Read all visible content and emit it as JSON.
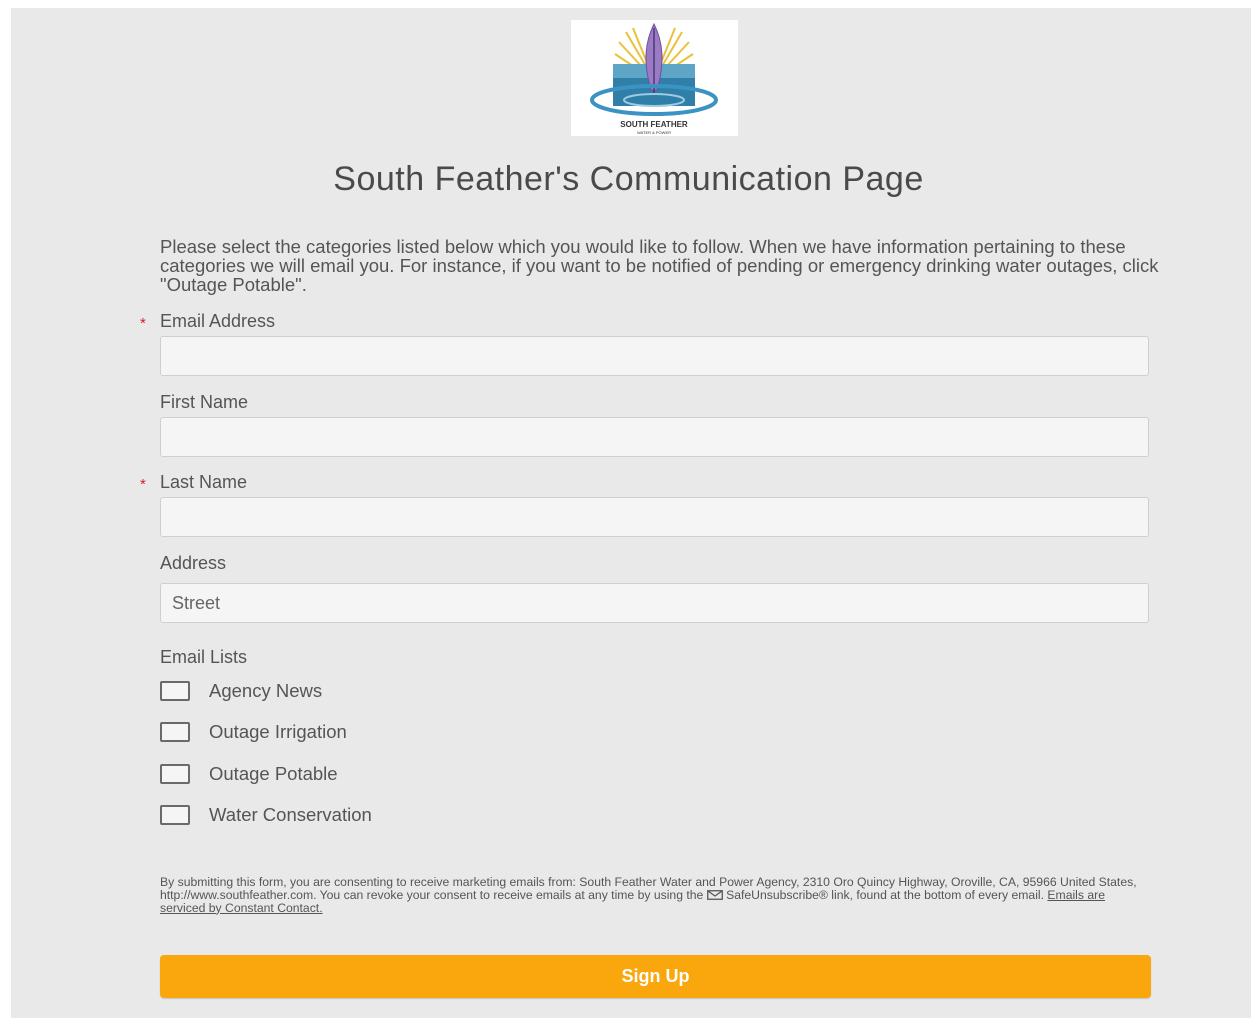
{
  "logo": {
    "text": "SOUTH FEATHER",
    "subtext": "WATER & POWER"
  },
  "page_title": "South Feather's Communication Page",
  "intro": "Please select the categories listed below which you would like to follow. When we have information pertaining to these categories we will email you. For instance, if you want to be notified of pending or emergency drinking water outages, click \"Outage Potable\".",
  "form": {
    "required_marker": "*",
    "email_label": "Email Address",
    "email_value": "",
    "first_name_label": "First Name",
    "first_name_value": "",
    "last_name_label": "Last Name",
    "last_name_value": "",
    "address_label": "Address",
    "street_placeholder": "Street",
    "email_lists_label": "Email Lists",
    "lists": [
      {
        "label": "Agency News",
        "checked": false
      },
      {
        "label": "Outage Irrigation",
        "checked": false
      },
      {
        "label": "Outage Potable",
        "checked": false
      },
      {
        "label": "Water Conservation",
        "checked": false
      }
    ]
  },
  "legal": {
    "text_before": "By submitting this form, you are consenting to receive marketing emails from: South Feather Water and Power Agency, 2310 Oro Quincy Highway, Oroville, CA, 95966 United States, http://www.southfeather.com. You can revoke your consent to receive emails at any time by using the",
    "text_after": "SafeUnsubscribe® link, found at the bottom of every email.",
    "link_text": "Emails are serviced by Constant Contact.",
    "envelope_icon": "envelope-icon"
  },
  "signup_button": "Sign Up",
  "colors": {
    "background": "#e9e9e9",
    "button": "#f9a70d",
    "required": "#d0212f"
  }
}
